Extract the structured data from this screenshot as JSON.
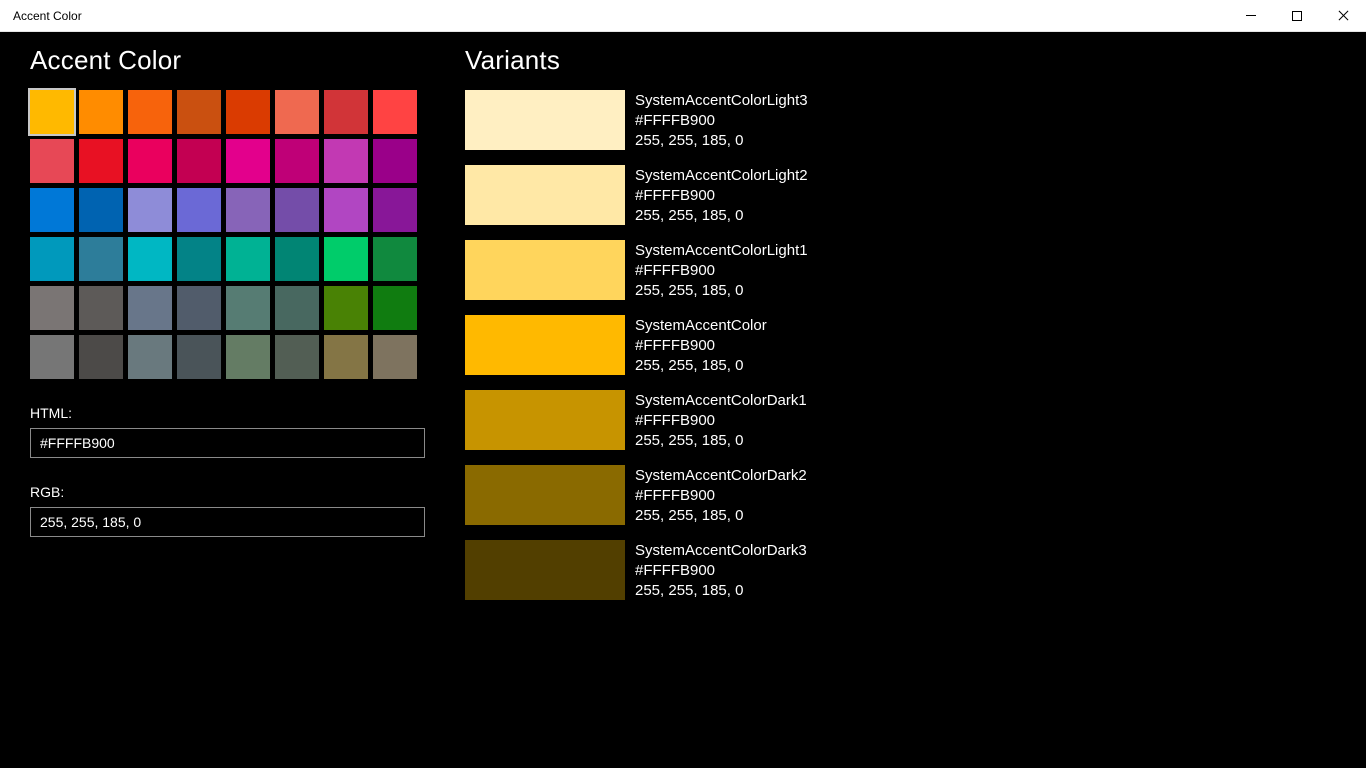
{
  "window": {
    "title": "Accent Color"
  },
  "left": {
    "heading": "Accent Color",
    "selected_index": 0,
    "palette": [
      "#FFB900",
      "#FF8C00",
      "#F7630C",
      "#CA5010",
      "#DA3B01",
      "#EF6950",
      "#D13438",
      "#FF4343",
      "#E74856",
      "#E81123",
      "#EA005E",
      "#C30052",
      "#E3008C",
      "#BF0077",
      "#C239B3",
      "#9A0089",
      "#0078D7",
      "#0063B1",
      "#8E8CD8",
      "#6B69D6",
      "#8764B8",
      "#744DA9",
      "#B146C2",
      "#881798",
      "#0099BC",
      "#2D7D9A",
      "#00B7C3",
      "#038387",
      "#00B294",
      "#018574",
      "#00CC6A",
      "#10893E",
      "#7A7574",
      "#5D5A58",
      "#68768A",
      "#515C6B",
      "#567C73",
      "#486860",
      "#498205",
      "#107C10",
      "#767676",
      "#4C4A48",
      "#69797E",
      "#4A5459",
      "#647C64",
      "#525E54",
      "#847545",
      "#7E735F"
    ],
    "html_label": "HTML:",
    "html_value": "#FFFFB900",
    "rgb_label": "RGB:",
    "rgb_value": "255, 255, 185, 0"
  },
  "right": {
    "heading": "Variants",
    "variants": [
      {
        "name": "SystemAccentColorLight3",
        "hex": "#FFFFB900",
        "rgb": "255, 255, 185, 0",
        "color": "#FFEFC2"
      },
      {
        "name": "SystemAccentColorLight2",
        "hex": "#FFFFB900",
        "rgb": "255, 255, 185, 0",
        "color": "#FFE8A6"
      },
      {
        "name": "SystemAccentColorLight1",
        "hex": "#FFFFB900",
        "rgb": "255, 255, 185, 0",
        "color": "#FFD55C"
      },
      {
        "name": "SystemAccentColor",
        "hex": "#FFFFB900",
        "rgb": "255, 255, 185, 0",
        "color": "#FFB900"
      },
      {
        "name": "SystemAccentColorDark1",
        "hex": "#FFFFB900",
        "rgb": "255, 255, 185, 0",
        "color": "#C79400"
      },
      {
        "name": "SystemAccentColorDark2",
        "hex": "#FFFFB900",
        "rgb": "255, 255, 185, 0",
        "color": "#8A6A00"
      },
      {
        "name": "SystemAccentColorDark3",
        "hex": "#FFFFB900",
        "rgb": "255, 255, 185, 0",
        "color": "#523F00"
      }
    ]
  }
}
